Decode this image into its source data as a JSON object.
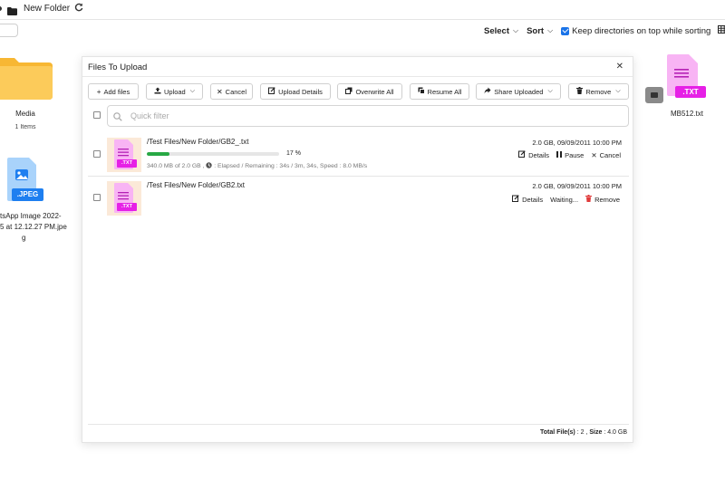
{
  "breadcrumb": {
    "folder_name": "New Folder"
  },
  "toolbar": {
    "select_label": "Select",
    "sort_label": "Sort",
    "keep_dirs_label": "Keep directories on top while sorting"
  },
  "background_files": [
    {
      "name": "Media",
      "sub": "1 Items",
      "icon": "folder-icon"
    },
    {
      "name_lines": [
        "tsApp Image 2022-",
        "5 at 12.12.27 PM.jpe",
        "g"
      ],
      "badge": ".JPEG",
      "icon": "jpeg-file-icon"
    },
    {
      "name": "MB512.txt",
      "badge": ".TXT",
      "icon": "txt-file-icon"
    }
  ],
  "modal": {
    "title": "Files To Upload",
    "buttons": {
      "add_files": "Add files",
      "upload": "Upload",
      "cancel": "Cancel",
      "upload_details": "Upload Details",
      "overwrite_all": "Overwrite All",
      "resume_all": "Resume All",
      "share_uploaded": "Share Uploaded",
      "remove": "Remove"
    },
    "filter_placeholder": "Quick filter",
    "rows": [
      {
        "path": "/Test Files/New Folder/GB2_.txt",
        "meta": "2.0 GB, 09/09/2011 10:00 PM",
        "badge": ".TXT",
        "progress_percent": 17,
        "progress_label": "17 %",
        "detail_size": "340.0 MB of 2.0 GB ,",
        "detail_timing": ": Elapsed / Remaining : 34s / 3m, 34s, Speed : 8.0 MB/s",
        "actions": {
          "details": "Details",
          "pause": "Pause",
          "cancel": "Cancel"
        }
      },
      {
        "path": "/Test Files/New Folder/GB2.txt",
        "meta": "2.0 GB, 09/09/2011 10:00 PM",
        "badge": ".TXT",
        "status": "Waiting...",
        "actions": {
          "details": "Details",
          "remove": "Remove"
        }
      }
    ],
    "footer": {
      "total_label": "Total File(s)",
      "total_value": ": 2 ,",
      "size_label": "Size",
      "size_value": ": 4.0 GB"
    }
  },
  "colors": {
    "accent": "#1a73e8",
    "progress": "#27a844",
    "txt_badge": "#e620e6",
    "jpeg_badge": "#1e7ff0",
    "folder": "#fbc341",
    "remove_icon": "#e03b3b"
  }
}
